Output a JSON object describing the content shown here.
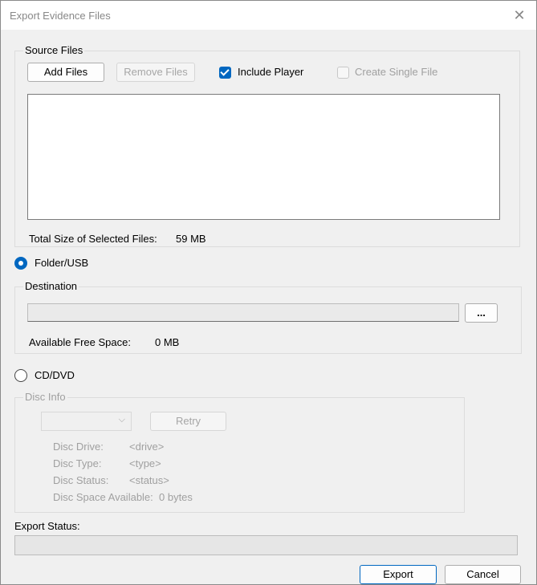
{
  "window": {
    "title": "Export Evidence Files",
    "close_glyph": "✕"
  },
  "source_files": {
    "group_label": "Source Files",
    "add_label": "Add Files",
    "remove_label": "Remove Files",
    "include_player": {
      "label": "Include Player",
      "checked": true
    },
    "create_single_file": {
      "label": "Create Single File",
      "checked": false,
      "enabled": false
    },
    "total_size_label": "Total Size of Selected Files:",
    "total_size_value": "59 MB"
  },
  "folder_usb": {
    "label": "Folder/USB",
    "selected": true,
    "destination_label": "Destination",
    "destination_value": "",
    "browse_label": "...",
    "free_space_label": "Available Free Space:",
    "free_space_value": "0 MB"
  },
  "cd_dvd": {
    "label": "CD/DVD",
    "selected": false,
    "disc_info_label": "Disc Info",
    "drive_select_value": "",
    "retry_label": "Retry",
    "disc_drive_label": "Disc Drive:",
    "disc_drive_value": "<drive>",
    "disc_type_label": "Disc Type:",
    "disc_type_value": "<type>",
    "disc_status_label": "Disc Status:",
    "disc_status_value": "<status>",
    "disc_space_label": "Disc Space Available:",
    "disc_space_value": "0 bytes"
  },
  "export_status": {
    "label": "Export Status:",
    "progress": 0
  },
  "footer": {
    "export_label": "Export",
    "cancel_label": "Cancel"
  },
  "colors": {
    "accent": "#0067c0",
    "disabled_text": "#a0a0a0",
    "background": "#f0f0f0"
  }
}
